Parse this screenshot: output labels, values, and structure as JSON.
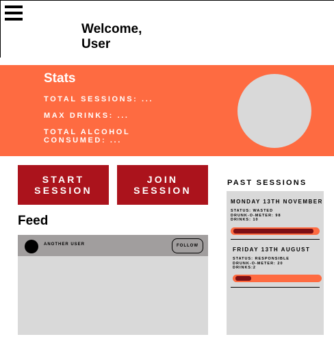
{
  "header": {
    "welcome_line1": "Welcome,",
    "welcome_line2": "User"
  },
  "stats": {
    "title": "Stats",
    "total_sessions": "TOTAL SESSIONS: ...",
    "max_drinks": "MAX DRINKS: ...",
    "total_alcohol_line1": "TOTAL ALCOHOL",
    "total_alcohol_line2": "CONSUMED: ..."
  },
  "actions": {
    "start_line1": "START",
    "start_line2": "SESSION",
    "join_line1": "JOIN",
    "join_line2": "SESSION"
  },
  "feed": {
    "title": "Feed",
    "user": "ANOTHER USER",
    "follow_label": "FOLLOW"
  },
  "past_sessions": {
    "title": "PAST SESSIONS",
    "items": [
      {
        "date": "MONDAY 13TH NOVEMBER",
        "status": "STATUS: WASTED",
        "meter": "DRUNK-O-METER: 98",
        "drinks": "DRINKS: 10",
        "level": 0.96
      },
      {
        "date": "FRIDAY 13TH AUGUST",
        "status": "STATUS: RESPONSIBLE",
        "meter": "DRUNK-O-METER: 20",
        "drinks": "DRINKS:2",
        "level": 0.19
      }
    ]
  },
  "colors": {
    "accent": "#fe6b41",
    "button": "#ab131c",
    "meter_fill": "#7c0f14",
    "panel": "#d9d9d9"
  },
  "icons": {
    "menu": "hamburger-menu-icon"
  }
}
